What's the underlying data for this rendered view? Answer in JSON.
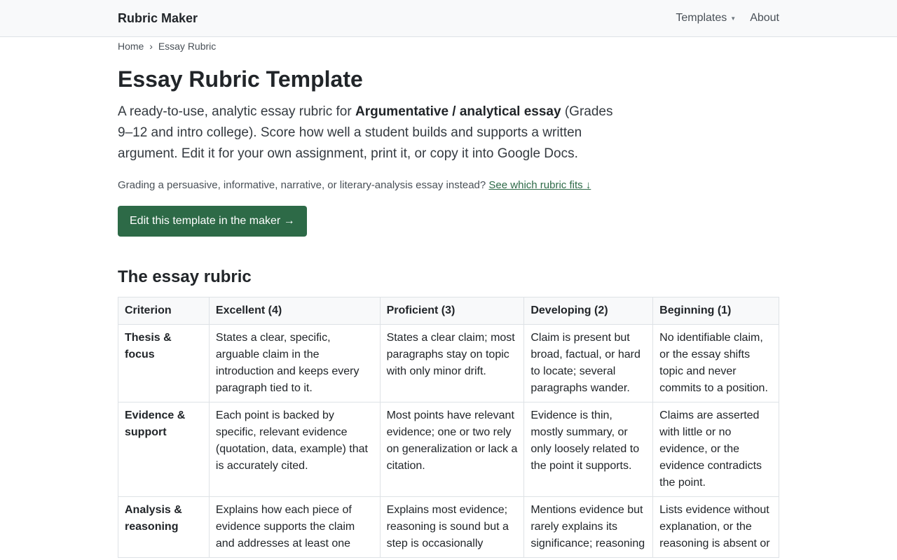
{
  "nav": {
    "brand": "Rubric Maker",
    "items": [
      {
        "label": "Templates",
        "has_dropdown": true
      },
      {
        "label": "About"
      }
    ]
  },
  "breadcrumb": {
    "home": "Home",
    "separator": "›",
    "current": "Essay Rubric"
  },
  "page": {
    "title": "Essay Rubric Template",
    "lead_before": "A ready-to-use, analytic essay rubric for ",
    "lead_strong": "Argumentative / analytical essay",
    "lead_after": " (Grades 9–12 and intro college). Score how well a student builds and supports a written argument. Edit it for your own assignment, print it, or copy it into Google Docs.",
    "alt_note": "Grading a persuasive, informative, narrative, or literary-analysis essay instead? ",
    "alt_link": "See which rubric fits ↓",
    "cta_label": "Edit this template in the maker →",
    "section_title": "The essay rubric"
  },
  "rubric": {
    "headers": [
      "Criterion",
      "Excellent (4)",
      "Proficient (3)",
      "Developing (2)",
      "Beginning (1)"
    ],
    "rows": [
      {
        "criterion": "Thesis & focus",
        "cells": [
          "States a clear, specific, arguable claim in the introduction and keeps every paragraph tied to it.",
          "States a clear claim; most paragraphs stay on topic with only minor drift.",
          "Claim is present but broad, factual, or hard to locate; several paragraphs wander.",
          "No identifiable claim, or the essay shifts topic and never commits to a position."
        ]
      },
      {
        "criterion": "Evidence & support",
        "cells": [
          "Each point is backed by specific, relevant evidence (quotation, data, example) that is accurately cited.",
          "Most points have relevant evidence; one or two rely on generalization or lack a citation.",
          "Evidence is thin, mostly summary, or only loosely related to the point it supports.",
          "Claims are asserted with little or no evidence, or the evidence contradicts the point."
        ]
      },
      {
        "criterion": "Analysis & reasoning",
        "cells": [
          "Explains how each piece of evidence supports the claim and addresses at least one",
          "Explains most evidence; reasoning is sound but a step is occasionally",
          "Mentions evidence but rarely explains its significance; reasoning",
          "Lists evidence without explanation, or the reasoning is absent or"
        ]
      }
    ]
  },
  "colors": {
    "accent": "#2d6a47",
    "topbar_bg": "#f8f9fa",
    "border": "#dee2e6"
  }
}
